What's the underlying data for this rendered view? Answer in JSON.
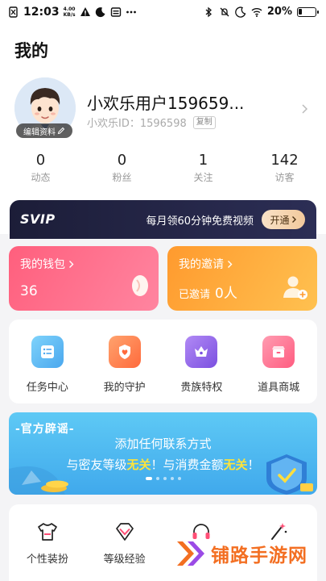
{
  "status_bar": {
    "time": "12:03",
    "net_speed_value": "4.00",
    "net_speed_unit": "KB/s",
    "battery_percent": "20%",
    "battery_level": 0.2,
    "left_icons": [
      "sim-off-icon",
      "warning-icon",
      "moon-icon",
      "card-icon",
      "more-dots-icon"
    ],
    "right_icons": [
      "bluetooth-icon",
      "mute-icon",
      "moon-icon",
      "wifi-icon",
      "battery-icon"
    ]
  },
  "page_title": "我的",
  "profile": {
    "username": "小欢乐用户159659...",
    "user_id": "小欢乐ID：1596598",
    "copy_label": "复制",
    "edit_label": "编辑资料"
  },
  "stats": [
    {
      "value": "0",
      "label": "动态"
    },
    {
      "value": "0",
      "label": "粉丝"
    },
    {
      "value": "1",
      "label": "关注"
    },
    {
      "value": "142",
      "label": "访客"
    }
  ],
  "svip": {
    "logo": "SVIP",
    "text": "每月领60分钟免费视频",
    "button": "开通"
  },
  "wallet": {
    "title": "我的钱包",
    "value": "36"
  },
  "invite": {
    "title": "我的邀请",
    "label": "已邀请",
    "count": "0人"
  },
  "menu": [
    {
      "label": "任务中心",
      "icon": "task-icon",
      "color": "#4bb6f0"
    },
    {
      "label": "我的守护",
      "icon": "guard-icon",
      "color": "#ff7a48"
    },
    {
      "label": "贵族特权",
      "icon": "crown-icon",
      "color": "#8b5ce6"
    },
    {
      "label": "道具商城",
      "icon": "store-icon",
      "color": "#ff6b8a"
    }
  ],
  "banner": {
    "tag": "-官方辟谣-",
    "line1": "添加任何联系方式",
    "line2_a": "与密友等级",
    "line2_b": "无关",
    "line2_c": "！与消费金额",
    "line2_d": "无关",
    "line2_e": "！",
    "page_count": 5,
    "active_page": 1
  },
  "bottom_menu": [
    {
      "label": "个性装扮",
      "icon": "tshirt-icon"
    },
    {
      "label": "等级经验",
      "icon": "diamond-icon"
    },
    {
      "label": "",
      "icon": "headset-icon"
    },
    {
      "label": "",
      "icon": "magic-wand-icon"
    }
  ],
  "watermark": "铺路手游网",
  "colors": {
    "wallet": "#ff6b88",
    "invite": "#ffa93a",
    "svip_bg": "#1f2142",
    "banner": "#4fb8f0",
    "highlight": "#ffe43a",
    "watermark": "#f36f22"
  }
}
